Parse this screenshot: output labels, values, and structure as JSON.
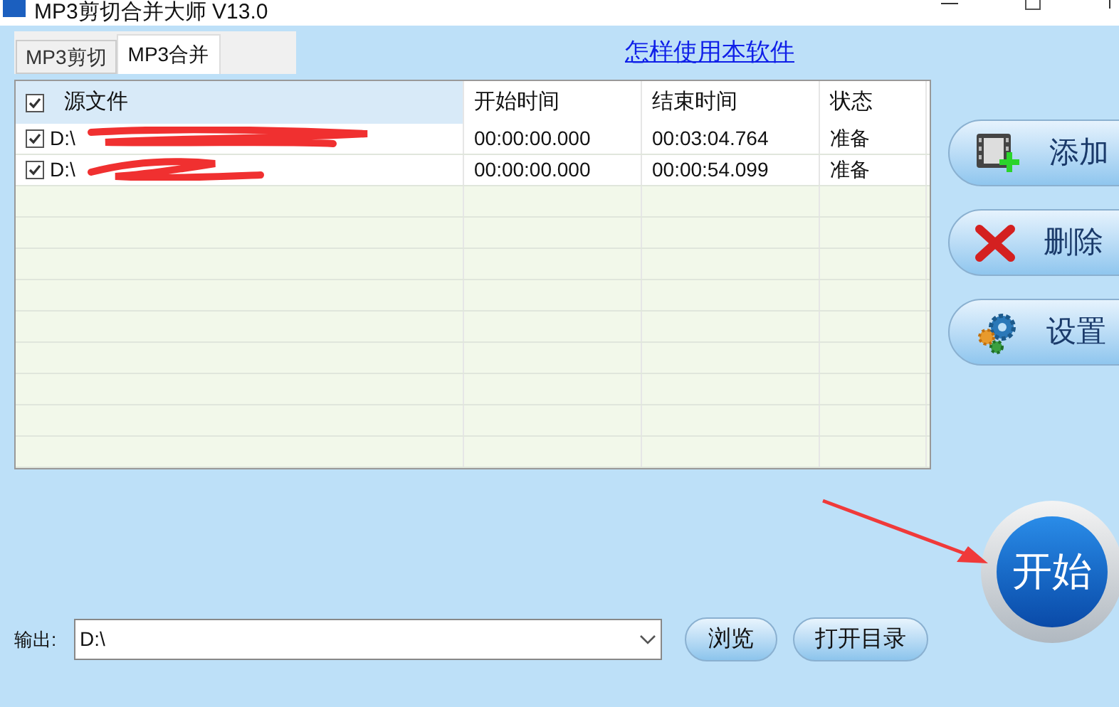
{
  "window": {
    "title": "MP3剪切合并大师 V13.0"
  },
  "tabs": [
    {
      "label": "MP3剪切",
      "selected": false
    },
    {
      "label": "MP3合并",
      "selected": true
    }
  ],
  "help_link": "怎样使用本软件",
  "table": {
    "select_all_checked": true,
    "columns": [
      "源文件",
      "开始时间",
      "结束时间",
      "状态"
    ],
    "rows": [
      {
        "checked": true,
        "file": "D:\\",
        "start": "00:00:00.000",
        "end": "00:03:04.764",
        "status": "准备"
      },
      {
        "checked": true,
        "file": "D:\\",
        "start": "00:00:00.000",
        "end": "00:00:54.099",
        "status": "准备"
      }
    ]
  },
  "side_buttons": [
    {
      "kind": "add",
      "label": "添加"
    },
    {
      "kind": "delete",
      "label": "删除"
    },
    {
      "kind": "settings",
      "label": "设置"
    }
  ],
  "start_button": "开始",
  "output": {
    "label": "输出:",
    "value": "D:\\"
  },
  "bottom_buttons": [
    "浏览",
    "打开目录"
  ]
}
